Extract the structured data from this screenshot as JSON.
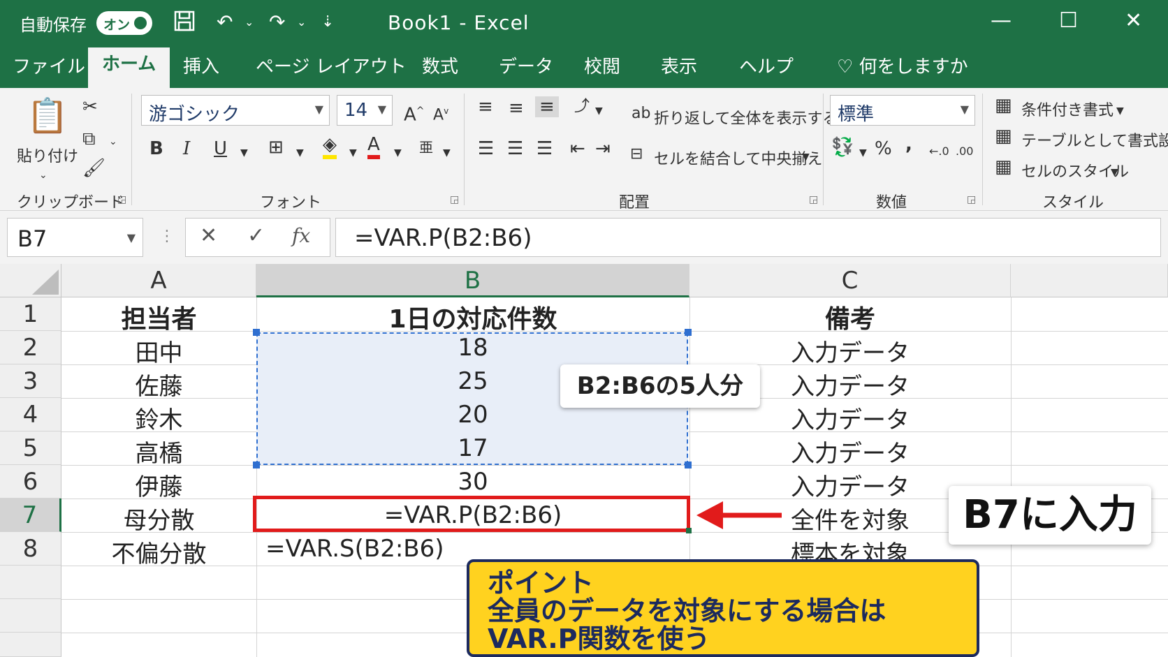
{
  "titlebar": {
    "autosave_label": "自動保存",
    "autosave_state": "オン",
    "title": "Book1  -  Excel"
  },
  "tabs": [
    "ファイル",
    "ホーム",
    "挿入",
    "ページ レイアウト",
    "数式",
    "データ",
    "校閲",
    "表示",
    "ヘルプ"
  ],
  "active_tab": "ホーム",
  "tell_me": "何をしますか",
  "ribbon": {
    "clipboard": {
      "paste": "貼り付け",
      "label": "クリップボード"
    },
    "font": {
      "name": "游ゴシック",
      "size": "14",
      "label": "フォント"
    },
    "alignment": {
      "wrap": "折り返して全体を表示する",
      "merge": "セルを結合して中央揃え",
      "label": "配置"
    },
    "number": {
      "format": "標準",
      "percent": "%",
      "comma": ",",
      "label": "数値"
    },
    "styles": {
      "conditional": "条件付き書式",
      "table": "テーブルとして書式設定",
      "cell_styles": "セルのスタイル",
      "label": "スタイル"
    }
  },
  "formula_bar": {
    "name_box": "B7",
    "formula": "=VAR.P(B2:B6)"
  },
  "sheet": {
    "columns": [
      "A",
      "B",
      "C"
    ],
    "rows": [
      "1",
      "2",
      "3",
      "4",
      "5",
      "6",
      "7",
      "8"
    ],
    "headers": [
      "担当者",
      "1日の対応件数",
      "備考"
    ],
    "data": [
      [
        "田中",
        "18",
        "入力データ"
      ],
      [
        "佐藤",
        "25",
        "入力データ"
      ],
      [
        "鈴木",
        "20",
        "入力データ"
      ],
      [
        "高橋",
        "17",
        "入力データ"
      ],
      [
        "伊藤",
        "30",
        "入力データ"
      ],
      [
        "母分散",
        "=VAR.P(B2:B6)",
        "全件を対象"
      ],
      [
        "不偏分散",
        "=VAR.S(B2:B6)",
        "標本を対象"
      ]
    ]
  },
  "annotations": {
    "range_label": "B2:B6の5人分",
    "input_label": "B7に入力",
    "point_title": "ポイント",
    "point_line1": "全員のデータを対象にする場合は",
    "point_line2": "VAR.P関数を使う"
  },
  "colors": {
    "excel_green": "#1e7145",
    "highlight_red": "#e11b1b",
    "point_yellow": "#ffd21f",
    "point_navy": "#1c2a5e",
    "range_blue": "#2f6fd0"
  }
}
